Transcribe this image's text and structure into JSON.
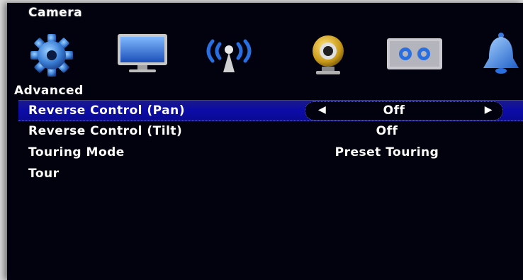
{
  "header": {
    "title": "Camera"
  },
  "toolbar": {
    "icons": [
      "gear-icon",
      "monitor-icon",
      "wireless-antenna-icon",
      "webcam-icon",
      "storage-icon",
      "bell-icon"
    ]
  },
  "section": {
    "title": "Advanced"
  },
  "settings": [
    {
      "label": "Reverse Control (Pan)",
      "value": "Off",
      "selected": true
    },
    {
      "label": "Reverse Control (Tilt)",
      "value": "Off"
    },
    {
      "label": "Touring Mode",
      "value": "Preset Touring"
    },
    {
      "label": "Tour",
      "value": ""
    }
  ],
  "colors": {
    "highlight": "#0c0ca8",
    "background": "#02020e",
    "text": "#ffffff"
  }
}
